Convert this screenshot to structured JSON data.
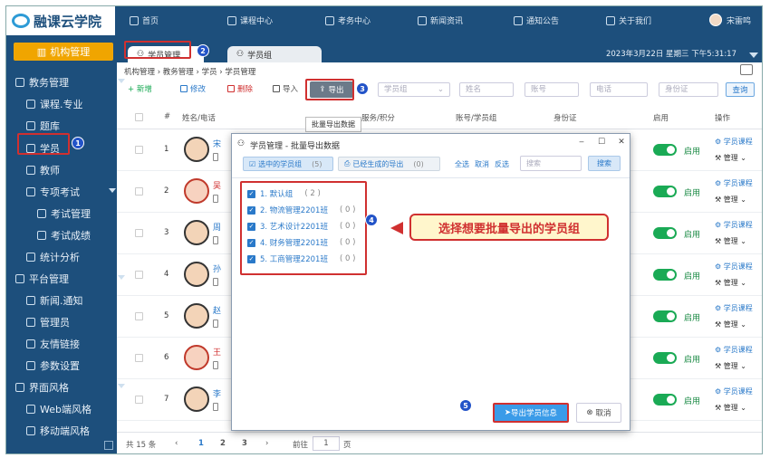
{
  "logo": {
    "text": "融课云学院"
  },
  "nav": [
    {
      "label": "首页",
      "icon": "home-icon"
    },
    {
      "label": "课程中心",
      "icon": "monitor-icon"
    },
    {
      "label": "考务中心",
      "icon": "calendar-icon"
    },
    {
      "label": "新闻资讯",
      "icon": "eye-icon"
    },
    {
      "label": "通知公告",
      "icon": "pin-icon"
    },
    {
      "label": "关于我们",
      "icon": "user-icon"
    }
  ],
  "user": {
    "name": "宋雷鸣"
  },
  "sidebar": {
    "org": "机构管理",
    "items": [
      {
        "label": "教务管理"
      },
      {
        "label": "课程.专业"
      },
      {
        "label": "题库"
      },
      {
        "label": "学员"
      },
      {
        "label": "教师"
      },
      {
        "label": "专项考试"
      },
      {
        "label": "考试管理"
      },
      {
        "label": "考试成绩"
      },
      {
        "label": "统计分析"
      },
      {
        "label": "平台管理"
      },
      {
        "label": "新闻.通知"
      },
      {
        "label": "管理员"
      },
      {
        "label": "友情链接"
      },
      {
        "label": "参数设置"
      },
      {
        "label": "界面风格"
      },
      {
        "label": "Web端风格"
      },
      {
        "label": "移动端风格"
      }
    ]
  },
  "tabs": [
    {
      "label": "学员管理"
    },
    {
      "label": "学员组"
    }
  ],
  "datetime": "2023年3月22日 星期三 下午5:31:17",
  "breadcrumb": "机构管理 › 教务管理 › 学员 › 学员管理",
  "toolbar": {
    "add": "+ 新增",
    "edit": "修改",
    "delete": "删除",
    "import": "导入",
    "export": "导出",
    "filters": [
      "学员组",
      "姓名",
      "账号",
      "电话",
      "身份证"
    ],
    "query": "查询"
  },
  "tooltip": "批量导出数据",
  "table": {
    "headers": [
      "#",
      "姓名/电话",
      "服务/积分",
      "账号/学员组",
      "身份证",
      "启用",
      "操作"
    ],
    "rows": [
      {
        "num": "1",
        "initial": "宋",
        "gender": "m"
      },
      {
        "num": "2",
        "initial": "吴",
        "gender": "f"
      },
      {
        "num": "3",
        "initial": "周",
        "gender": "m"
      },
      {
        "num": "4",
        "initial": "孙",
        "gender": "m"
      },
      {
        "num": "5",
        "initial": "赵",
        "gender": "m"
      },
      {
        "num": "6",
        "initial": "王",
        "gender": "f"
      },
      {
        "num": "7",
        "initial": "李",
        "gender": "m"
      }
    ],
    "enabled_label": "启用",
    "op_course": "学员课程",
    "op_manage": "管理"
  },
  "pager": {
    "total": "共 15 条",
    "prev": "‹",
    "pages": [
      "1",
      "2",
      "3"
    ],
    "next": "›",
    "goto": "前往",
    "page_value": "1",
    "page_unit": "页"
  },
  "modal": {
    "title": "学员管理 - 批量导出数据",
    "tab_selected": "选中的学员组",
    "tab_selected_count": "(5)",
    "tab_generated": "已经生成的导出",
    "tab_generated_count": "(0)",
    "select_all": "全选",
    "cancel_select": "取消",
    "invert": "反选",
    "search_placeholder": "搜索",
    "search_btn": "搜索",
    "groups": [
      {
        "label": "1. 默认组",
        "count": "( 2 )"
      },
      {
        "label": "2. 物流管理2201班",
        "count": "( 0 )"
      },
      {
        "label": "3. 艺术设计2201班",
        "count": "( 0 )"
      },
      {
        "label": "4. 财务管理2201班",
        "count": "( 0 )"
      },
      {
        "label": "5. 工商管理2201班",
        "count": "( 0 )"
      }
    ],
    "export_btn": "导出学员信息",
    "cancel_btn": "取消"
  },
  "callout": "选择想要批量导出的学员组",
  "annotations": [
    "1",
    "2",
    "3",
    "4",
    "5"
  ]
}
